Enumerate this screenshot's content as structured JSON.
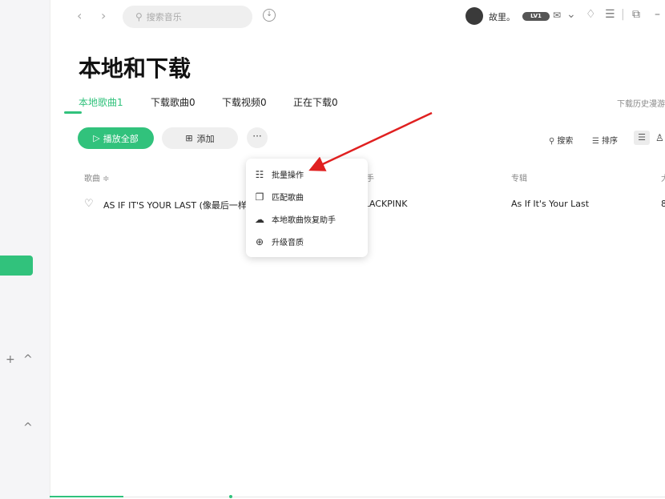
{
  "topbar": {
    "search_placeholder": "搜索音乐",
    "username": "故里。",
    "badge": "LV1"
  },
  "page": {
    "title": "本地和下载",
    "history_link": "下载历史漫游"
  },
  "tabs": [
    {
      "label": "本地歌曲1",
      "active": true
    },
    {
      "label": "下载歌曲0",
      "active": false
    },
    {
      "label": "下载视频0",
      "active": false
    },
    {
      "label": "正在下载0",
      "active": false
    }
  ],
  "actions": {
    "play_all": "播放全部",
    "add": "添加",
    "more": "···",
    "search": "搜索",
    "sort": "排序"
  },
  "table": {
    "headers": {
      "song": "歌曲 ≑",
      "singer": "歌手",
      "album": "专辑",
      "duration": "大"
    },
    "rows": [
      {
        "song": "AS IF IT'S YOUR LAST (像最后一样)",
        "singer": "BLACKPINK",
        "album": "As If It's Your Last",
        "duration": "8"
      }
    ]
  },
  "menu": {
    "items": [
      {
        "label": "批量操作",
        "icon": "list-check-icon"
      },
      {
        "label": "匹配歌曲",
        "icon": "copy-icon"
      },
      {
        "label": "本地歌曲恢复助手",
        "icon": "cloud-icon"
      },
      {
        "label": "升级音质",
        "icon": "arrow-up-circle-icon"
      }
    ]
  },
  "colors": {
    "accent": "#31c27c",
    "arrow": "#e02020"
  }
}
